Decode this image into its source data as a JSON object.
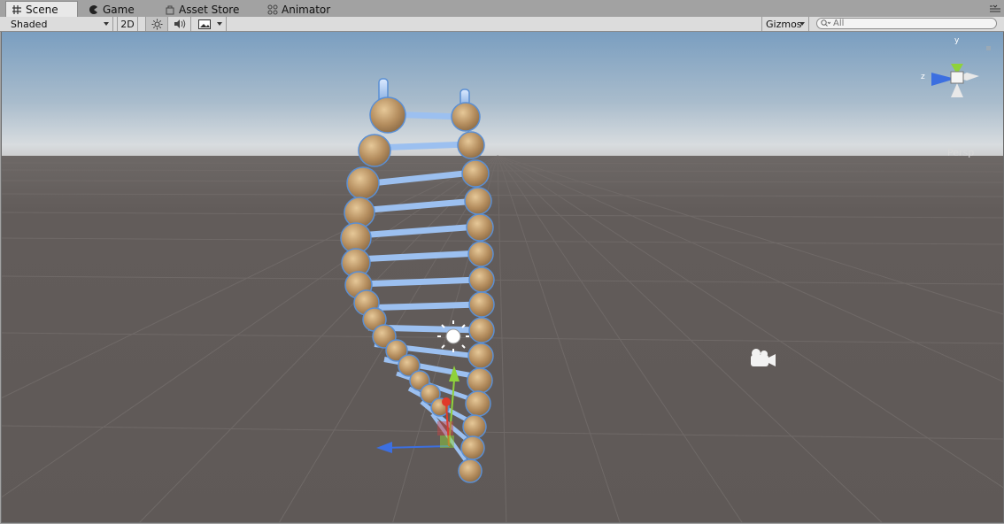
{
  "tabs": [
    {
      "label": "Scene",
      "icon": "grid-icon",
      "active": true
    },
    {
      "label": "Game",
      "icon": "pacman-icon",
      "active": false
    },
    {
      "label": "Asset Store",
      "icon": "bag-icon",
      "active": false
    },
    {
      "label": "Animator",
      "icon": "nodes-icon",
      "active": false
    }
  ],
  "toolbar": {
    "draw_mode": "Shaded",
    "two_d_label": "2D",
    "lighting_icon": "sun-icon",
    "audio_icon": "speaker-icon",
    "effects_icon": "image-icon",
    "gizmos_label": "Gizmos",
    "search_placeholder": "All"
  },
  "scene": {
    "projection_label": "Persp",
    "axis_labels": {
      "y": "y",
      "z": "z"
    },
    "colors": {
      "sky_top": "#7a9ec0",
      "horizon": "#d9dde0",
      "ground": "#605a58",
      "sphere": "#c4a070",
      "rung": "#9cc0f0",
      "selection_outline": "#5b8fd3",
      "axis_x": "#e03a2a",
      "axis_y": "#8fd23b",
      "axis_z": "#3c6fe0"
    }
  }
}
